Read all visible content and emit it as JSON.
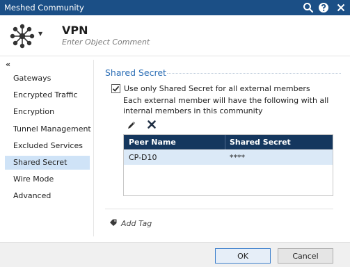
{
  "window": {
    "title": "Meshed Community"
  },
  "header": {
    "object_name": "VPN",
    "comment_placeholder": "Enter Object Comment"
  },
  "sidebar": {
    "collapse_glyph": "«",
    "items": [
      {
        "label": "Gateways"
      },
      {
        "label": "Encrypted Traffic"
      },
      {
        "label": "Encryption"
      },
      {
        "label": "Tunnel Management"
      },
      {
        "label": "Excluded Services"
      },
      {
        "label": "Shared Secret",
        "active": true
      },
      {
        "label": "Wire Mode"
      },
      {
        "label": "Advanced"
      }
    ]
  },
  "main": {
    "section_title": "Shared Secret",
    "checkbox": {
      "label": "Use only Shared Secret for all external members",
      "checked": true
    },
    "description": "Each external member will have the following with all internal members in this community",
    "table": {
      "columns": [
        "Peer Name",
        "Shared Secret"
      ],
      "rows": [
        {
          "peer_name": "CP-D10",
          "shared_secret": "****"
        }
      ]
    },
    "add_tag_label": "Add Tag"
  },
  "footer": {
    "ok_label": "OK",
    "cancel_label": "Cancel"
  },
  "colors": {
    "titlebar": "#1b4f86",
    "table_header": "#15375e",
    "accent": "#2a6db5",
    "selection": "#cfe3f7"
  }
}
